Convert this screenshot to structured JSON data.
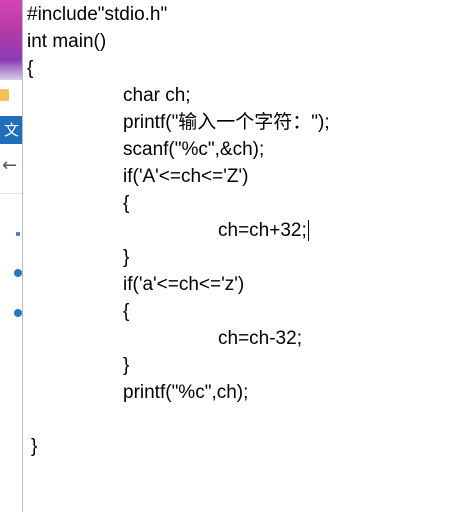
{
  "background": {
    "tab_glyph": "文",
    "back_arrow_icon": "left-arrow-icon"
  },
  "editor": {
    "lines": [
      "#include\"stdio.h\"",
      "int main()",
      "{",
      "char ch;",
      "printf(\"输入一个字符：\");",
      "scanf(\"%c\",&ch);",
      "if('A'<=ch<='Z')",
      "{",
      "ch=ch+32;",
      "}",
      "if('a'<=ch<='z')",
      "{",
      "ch=ch-32;",
      "}",
      "printf(\"%c\",ch);",
      "}"
    ],
    "caret_after_line": 9
  }
}
